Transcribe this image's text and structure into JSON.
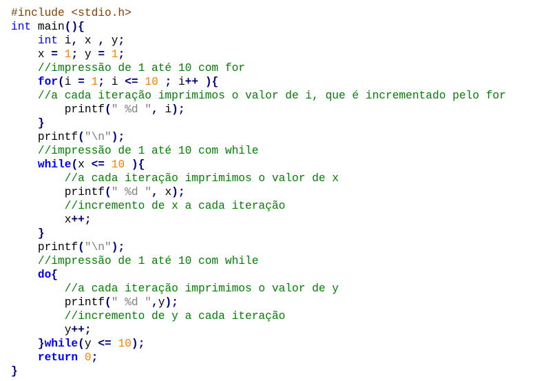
{
  "editor": {
    "language": "C",
    "colors": {
      "background": "#ffffff",
      "plain": "#000000",
      "keyword": "#0000ff",
      "number": "#ff8000",
      "string": "#808080",
      "comment": "#008000",
      "operator": "#000080",
      "preprocessor": "#804000"
    },
    "lines": [
      [
        [
          "pre",
          "#include <stdio.h>"
        ]
      ],
      [
        [
          "keyword",
          "int"
        ],
        [
          "plain",
          " main"
        ],
        [
          "op",
          "(){"
        ]
      ],
      [
        [
          "plain",
          "    "
        ],
        [
          "keyword",
          "int"
        ],
        [
          "plain",
          " i"
        ],
        [
          "op",
          ","
        ],
        [
          "plain",
          " x "
        ],
        [
          "op",
          ","
        ],
        [
          "plain",
          " y"
        ],
        [
          "op",
          ";"
        ]
      ],
      [
        [
          "plain",
          "    x "
        ],
        [
          "op",
          "="
        ],
        [
          "plain",
          " "
        ],
        [
          "number",
          "1"
        ],
        [
          "op",
          ";"
        ],
        [
          "plain",
          " y "
        ],
        [
          "op",
          "="
        ],
        [
          "plain",
          " "
        ],
        [
          "number",
          "1"
        ],
        [
          "op",
          ";"
        ]
      ],
      [
        [
          "plain",
          "    "
        ],
        [
          "comment",
          "//impressão de 1 até 10 com for"
        ]
      ],
      [
        [
          "plain",
          "    "
        ],
        [
          "kwbold",
          "for"
        ],
        [
          "op",
          "("
        ],
        [
          "plain",
          "i "
        ],
        [
          "op",
          "="
        ],
        [
          "plain",
          " "
        ],
        [
          "number",
          "1"
        ],
        [
          "op",
          ";"
        ],
        [
          "plain",
          " i "
        ],
        [
          "op",
          "<="
        ],
        [
          "plain",
          " "
        ],
        [
          "number",
          "10"
        ],
        [
          "plain",
          " "
        ],
        [
          "op",
          ";"
        ],
        [
          "plain",
          " i"
        ],
        [
          "op",
          "++"
        ],
        [
          "plain",
          " "
        ],
        [
          "op",
          "){"
        ]
      ],
      [
        [
          "plain",
          "    "
        ],
        [
          "comment",
          "//a cada iteração imprimimos o valor de i, que é incrementado pelo for"
        ]
      ],
      [
        [
          "plain",
          "        printf"
        ],
        [
          "op",
          "("
        ],
        [
          "string",
          "\" %d \""
        ],
        [
          "op",
          ","
        ],
        [
          "plain",
          " i"
        ],
        [
          "op",
          ");"
        ]
      ],
      [
        [
          "plain",
          "    "
        ],
        [
          "op",
          "}"
        ]
      ],
      [
        [
          "plain",
          "    printf"
        ],
        [
          "op",
          "("
        ],
        [
          "string",
          "\"\\n\""
        ],
        [
          "op",
          ");"
        ]
      ],
      [
        [
          "plain",
          "    "
        ],
        [
          "comment",
          "//impressão de 1 até 10 com while"
        ]
      ],
      [
        [
          "plain",
          "    "
        ],
        [
          "kwbold",
          "while"
        ],
        [
          "op",
          "("
        ],
        [
          "plain",
          "x "
        ],
        [
          "op",
          "<="
        ],
        [
          "plain",
          " "
        ],
        [
          "number",
          "10"
        ],
        [
          "plain",
          " "
        ],
        [
          "op",
          "){"
        ]
      ],
      [
        [
          "plain",
          "        "
        ],
        [
          "comment",
          "//a cada iteração imprimimos o valor de x"
        ]
      ],
      [
        [
          "plain",
          "        printf"
        ],
        [
          "op",
          "("
        ],
        [
          "string",
          "\" %d \""
        ],
        [
          "op",
          ","
        ],
        [
          "plain",
          " x"
        ],
        [
          "op",
          ");"
        ]
      ],
      [
        [
          "plain",
          "        "
        ],
        [
          "comment",
          "//incremento de x a cada iteração"
        ]
      ],
      [
        [
          "plain",
          "        x"
        ],
        [
          "op",
          "++;"
        ]
      ],
      [
        [
          "plain",
          "    "
        ],
        [
          "op",
          "}"
        ]
      ],
      [
        [
          "plain",
          "    printf"
        ],
        [
          "op",
          "("
        ],
        [
          "string",
          "\"\\n\""
        ],
        [
          "op",
          ");"
        ]
      ],
      [
        [
          "plain",
          "    "
        ],
        [
          "comment",
          "//impressão de 1 até 10 com while"
        ]
      ],
      [
        [
          "plain",
          "    "
        ],
        [
          "kwbold",
          "do"
        ],
        [
          "op",
          "{"
        ]
      ],
      [
        [
          "plain",
          "        "
        ],
        [
          "comment",
          "//a cada iteração imprimimos o valor de y"
        ]
      ],
      [
        [
          "plain",
          "        printf"
        ],
        [
          "op",
          "("
        ],
        [
          "string",
          "\" %d \""
        ],
        [
          "op",
          ","
        ],
        [
          "plain",
          "y"
        ],
        [
          "op",
          ");"
        ]
      ],
      [
        [
          "plain",
          "        "
        ],
        [
          "comment",
          "//incremento de y a cada iteração"
        ]
      ],
      [
        [
          "plain",
          "        y"
        ],
        [
          "op",
          "++;"
        ]
      ],
      [
        [
          "plain",
          "    "
        ],
        [
          "op",
          "}"
        ],
        [
          "kwbold",
          "while"
        ],
        [
          "op",
          "("
        ],
        [
          "plain",
          "y "
        ],
        [
          "op",
          "<="
        ],
        [
          "plain",
          " "
        ],
        [
          "number",
          "10"
        ],
        [
          "op",
          ");"
        ]
      ],
      [
        [
          "plain",
          "    "
        ],
        [
          "kwbold",
          "return"
        ],
        [
          "plain",
          " "
        ],
        [
          "number",
          "0"
        ],
        [
          "op",
          ";"
        ]
      ],
      [
        [
          "op",
          "}"
        ]
      ]
    ]
  }
}
